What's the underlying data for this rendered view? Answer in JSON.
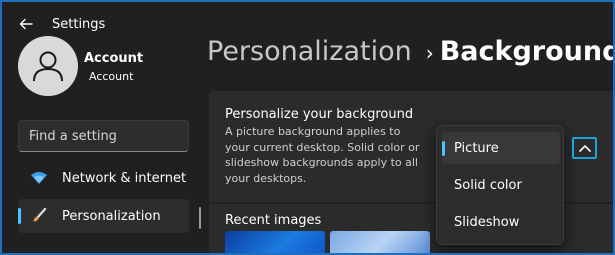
{
  "app": {
    "title": "Settings"
  },
  "account": {
    "name": "Account",
    "subtitle": "Account"
  },
  "search": {
    "placeholder": "Find a setting"
  },
  "sidebar": {
    "items": [
      {
        "label": "Network & internet",
        "icon": "wifi-icon"
      },
      {
        "label": "Personalization",
        "icon": "brush-icon",
        "active": true
      }
    ]
  },
  "header": {
    "parent": "Personalization",
    "separator": "›",
    "current": "Background"
  },
  "background_card": {
    "title": "Personalize your background",
    "description": "A picture background applies to your current desktop. Solid color or slideshow backgrounds apply to all your desktops.",
    "dropdown_options": [
      "Picture",
      "Solid color",
      "Slideshow"
    ],
    "selected": "Picture"
  },
  "recent": {
    "title": "Recent images"
  },
  "colors": {
    "accent": "#4cc2ff",
    "focus": "#1aa3e0",
    "background": "#202020"
  }
}
